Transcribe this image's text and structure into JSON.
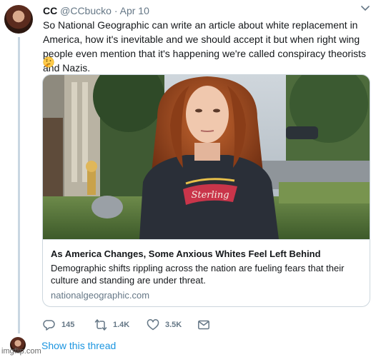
{
  "tweet": {
    "display_name": "CC",
    "handle": "@CCbucko",
    "separator": "·",
    "date": "Apr 10",
    "text": "So National Geographic can write an article about white replacement in America, how it's inevitable and we should accept it but when right wing people even mention that it's happening we're called conspiracy theorists and Nazis.",
    "emoji_icon": "thinking-face-icon",
    "avatar_icon": "user-avatar-icon",
    "menu_icon": "chevron-down-icon"
  },
  "card": {
    "image_icon": "article-photo",
    "title": "As America Changes, Some Anxious Whites Feel Left Behind",
    "description": "Demographic shifts rippling across the nation are fueling fears that their culture and standing are under threat.",
    "domain": "nationalgeographic.com",
    "sweatshirt_text": "Sterling"
  },
  "actions": [
    {
      "icon": "reply-icon",
      "count": "145"
    },
    {
      "icon": "retweet-icon",
      "count": "1.4K"
    },
    {
      "icon": "like-icon",
      "count": "3.5K"
    },
    {
      "icon": "direct-message-icon",
      "count": ""
    }
  ],
  "thread": {
    "show_label": "Show this thread"
  },
  "watermark": "imgflip.com",
  "colors": {
    "link_blue": "#1b95e0",
    "muted_gray": "#657786",
    "thread_line": "#c9d7e2",
    "card_border": "#ccd6dd"
  }
}
